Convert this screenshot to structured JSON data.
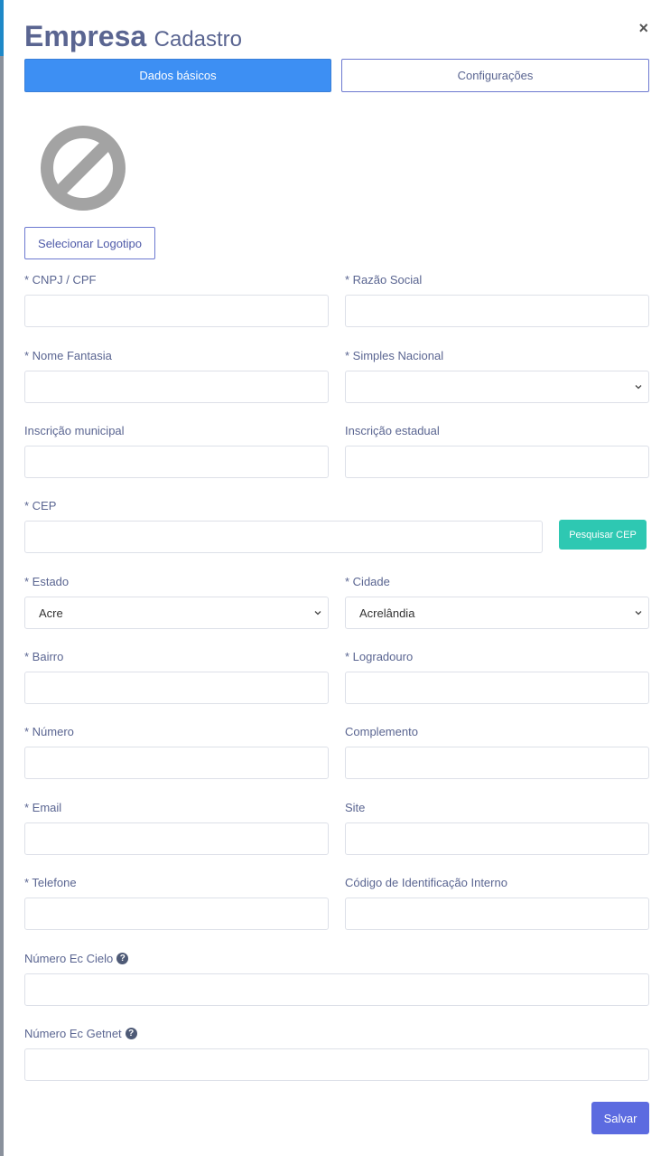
{
  "modal": {
    "title": "Empresa",
    "subtitle": "Cadastro",
    "close_icon": "close-icon"
  },
  "tabs": [
    {
      "label": "Dados básicos",
      "active": true
    },
    {
      "label": "Configurações",
      "active": false
    }
  ],
  "logo": {
    "placeholder_icon": "no-image-icon",
    "select_button": "Selecionar Logotipo"
  },
  "fields": {
    "cnpj": {
      "label": "* CNPJ / CPF",
      "value": ""
    },
    "razao_social": {
      "label": "* Razão Social",
      "value": ""
    },
    "nome_fantasia": {
      "label": "* Nome Fantasia",
      "value": ""
    },
    "simples_nacional": {
      "label": "* Simples Nacional",
      "value": ""
    },
    "inscricao_municipal": {
      "label": "Inscrição municipal",
      "value": ""
    },
    "inscricao_estadual": {
      "label": "Inscrição estadual",
      "value": ""
    },
    "cep": {
      "label": "* CEP",
      "value": "",
      "button": "Pesquisar CEP"
    },
    "estado": {
      "label": "* Estado",
      "value": "Acre"
    },
    "cidade": {
      "label": "* Cidade",
      "value": "Acrelândia"
    },
    "bairro": {
      "label": "* Bairro",
      "value": ""
    },
    "logradouro": {
      "label": "* Logradouro",
      "value": ""
    },
    "numero": {
      "label": "* Número",
      "value": ""
    },
    "complemento": {
      "label": "Complemento",
      "value": ""
    },
    "email": {
      "label": "* Email",
      "value": ""
    },
    "site": {
      "label": "Site",
      "value": ""
    },
    "telefone": {
      "label": "* Telefone",
      "value": ""
    },
    "codigo_interno": {
      "label": "Código de Identificação Interno",
      "value": ""
    },
    "ec_cielo": {
      "label": "Número Ec Cielo",
      "value": "",
      "help_icon": "question-circle-icon"
    },
    "ec_getnet": {
      "label": "Número Ec Getnet",
      "value": "",
      "help_icon": "question-circle-icon"
    }
  },
  "actions": {
    "save": "Salvar"
  },
  "colors": {
    "primary": "#3d8ff3",
    "accent": "#5c6be0",
    "teal": "#2ec8b2",
    "label": "#5a6591"
  }
}
